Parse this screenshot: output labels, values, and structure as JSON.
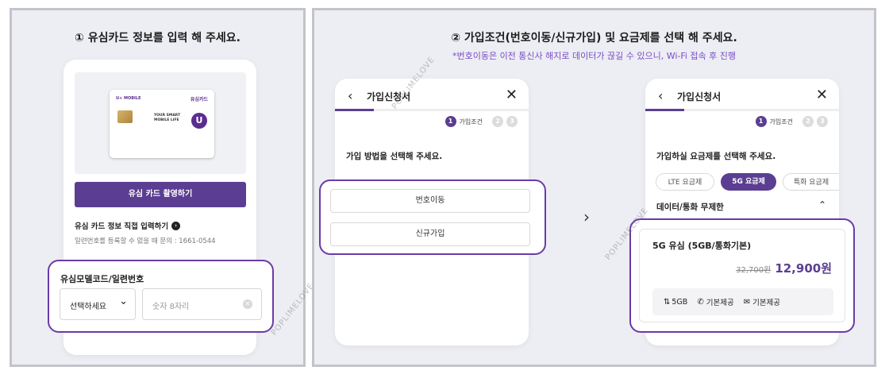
{
  "panel1": {
    "heading": "① 유심카드 정보를 입력 해 주세요.",
    "sim_card": {
      "brand": "U+ MOBILE",
      "title": "유심카드",
      "slogan": "YOUR SMART\nMOBILE LIFE",
      "logo_letter": "U"
    },
    "photo_button": "유심 카드 촬영하기",
    "direct_input_link": "유심 카드 정보 직접 입력하기",
    "help_text": "일련번호를 등록할 수 없을 때 문의 : 1661-0544",
    "field_label": "유심모델코드/일련번호",
    "select_value": "선택하세요",
    "input_placeholder": "숫자 8자리"
  },
  "panel2": {
    "heading": "② 가입조건(번호이동/신규가입) 및 요금제를 선택 해 주세요.",
    "note": "*번호이동은 이전 통신사 해지로 데이터가 끊길 수 있으니, Wi-Fi 접속 후 진행",
    "screen_a": {
      "title": "가입신청서",
      "step_label": "가입조건",
      "steps": [
        "1",
        "2",
        "3"
      ],
      "prompt": "가입 방법을 선택해 주세요.",
      "options": [
        "번호이동",
        "신규가입"
      ]
    },
    "screen_b": {
      "title": "가입신청서",
      "step_label": "가입조건",
      "steps": [
        "1",
        "2",
        "3"
      ],
      "prompt": "가입하실 요금제를 선택해 주세요.",
      "tabs": [
        "LTE 요금제",
        "5G 요금제",
        "특화 요금제"
      ],
      "section": "데이터/통화 무제한",
      "plan": {
        "name": "5G 유심 (5GB/통화기본)",
        "original_price": "32,700원",
        "price": "12,900원",
        "features": [
          "5GB",
          "기본제공",
          "기본제공"
        ]
      }
    }
  },
  "watermark": "POPLIMELOVE",
  "colors": {
    "accent": "#5b3e92",
    "highlight": "#6a3ba7"
  }
}
